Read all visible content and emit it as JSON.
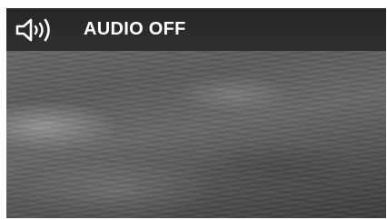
{
  "osd": {
    "icon": "speaker-icon",
    "status_text": "AUDIO OFF"
  },
  "colors": {
    "bar_background": "#2a2a2a",
    "text": "#ffffff",
    "icon": "#ffffff"
  }
}
